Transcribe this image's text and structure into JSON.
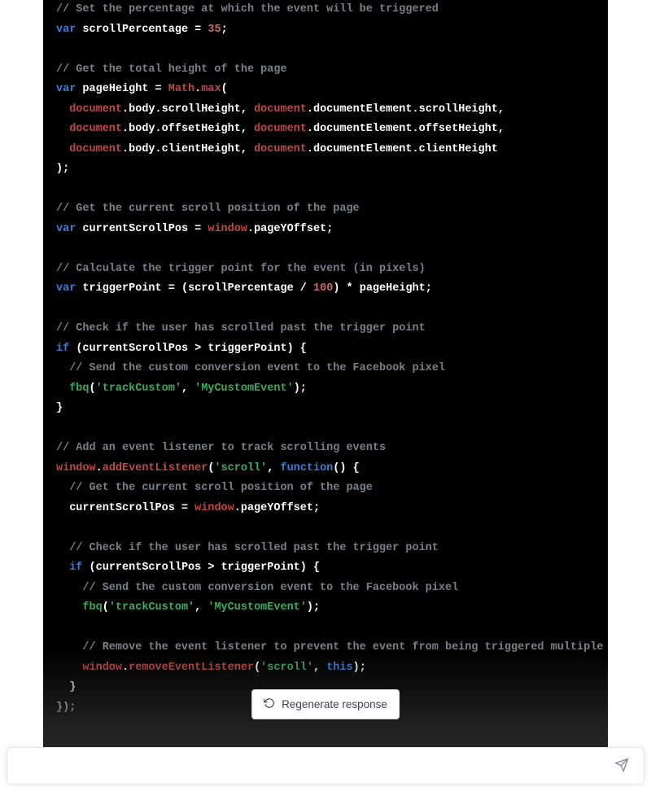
{
  "code": {
    "c1": "// Set the percentage at which the event will be triggered",
    "kw_var": "var",
    "v_scrollpct": "scrollPercentage",
    "eq": " = ",
    "n_35": "35",
    "semi": ";",
    "c2": "// Get the total height of the page",
    "v_pageheight": "pageHeight",
    "math": "Math",
    "dot": ".",
    "max": "max",
    "lp": "(",
    "rp": ")",
    "document": "document",
    "body": "body",
    "scrollHeight": "scrollHeight",
    "documentElement": "documentElement",
    "offsetHeight": "offsetHeight",
    "clientHeight": "clientHeight",
    "comma": ", ",
    "c3": "// Get the current scroll position of the page",
    "v_curscroll": "currentScrollPos",
    "window": "window",
    "pageYOffset": "pageYOffset",
    "c4": "// Calculate the trigger point for the event (in pixels)",
    "v_trigger": "triggerPoint",
    "slash": " / ",
    "n_100": "100",
    "star": " * ",
    "c5": "// Check if the user has scrolled past the trigger point",
    "kw_if": "if",
    "gt": " > ",
    "lb": " {",
    "rb": "}",
    "c6": "// Send the custom conversion event to the Facebook pixel",
    "fbq": "fbq",
    "s_trackCustom": "'trackCustom'",
    "s_myEvent": "'MyCustomEvent'",
    "c7": "// Add an event listener to track scrolling events",
    "addEventListener": "addEventListener",
    "s_scroll": "'scroll'",
    "kw_function": "function",
    "empty_parens": "()",
    "c8": "// Get the current scroll position of the page",
    "c9": "// Check if the user has scrolled past the trigger point",
    "c10": "// Send the custom conversion event to the Facebook pixel",
    "c11": "// Remove the event listener to prevent the event from being triggered multiple times",
    "removeEventListener": "removeEventListener",
    "kw_this": "this",
    "close_fn": "});"
  },
  "ui": {
    "regenerate": "Regenerate response",
    "input_placeholder": ""
  }
}
